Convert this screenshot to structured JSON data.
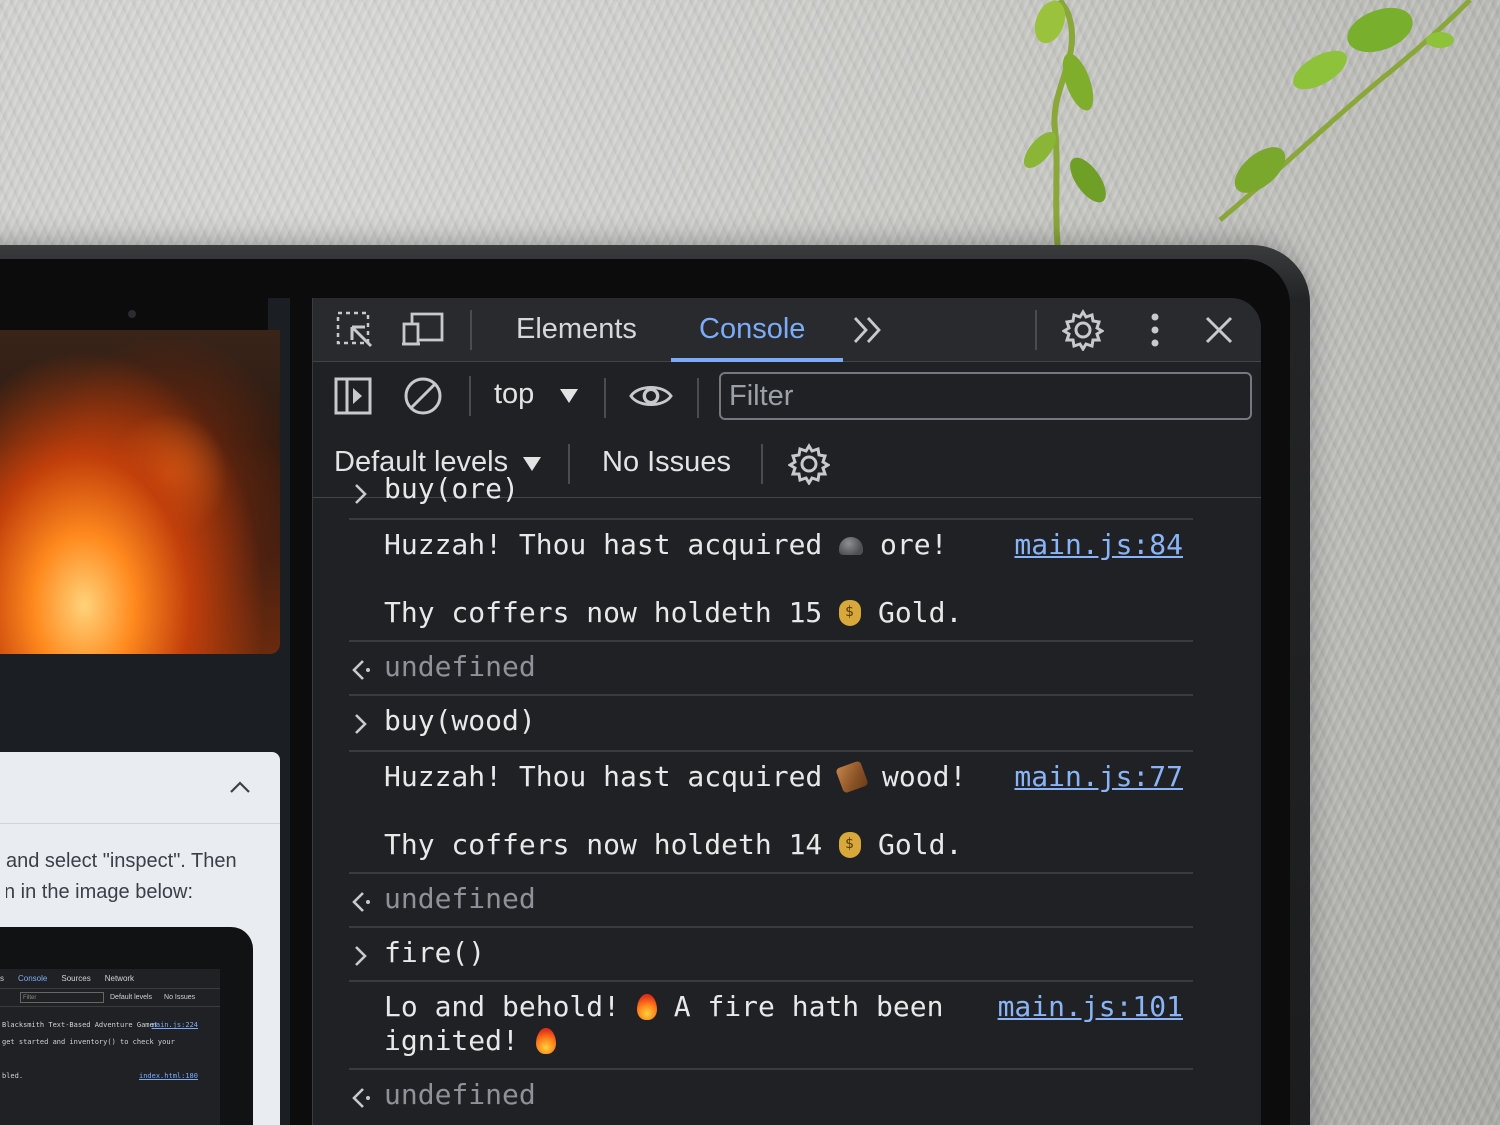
{
  "devtools": {
    "tabs": [
      {
        "label": "Elements"
      },
      {
        "label": "Console"
      }
    ],
    "context": "top",
    "filter_placeholder": "Filter",
    "levels": "Default levels",
    "issues": "No Issues"
  },
  "console": {
    "rows": [
      {
        "kind": "input-partial",
        "text": "buy(ore)"
      },
      {
        "kind": "log",
        "line1": "Huzzah! Thou hast acquired",
        "emoji1": "rock",
        "line1b": "ore!",
        "link": "main.js:84"
      },
      {
        "kind": "log2",
        "line": "Thy coffers now holdeth 15",
        "emoji": "money-bag",
        "lineb": "Gold."
      },
      {
        "kind": "return",
        "text": "undefined"
      },
      {
        "kind": "input",
        "text": "buy(wood)"
      },
      {
        "kind": "log",
        "line1": "Huzzah! Thou hast acquired",
        "emoji1": "wood",
        "line1b": "wood!",
        "link": "main.js:77"
      },
      {
        "kind": "log2",
        "line": "Thy coffers now holdeth 14",
        "emoji": "money-bag",
        "lineb": "Gold."
      },
      {
        "kind": "return",
        "text": "undefined"
      },
      {
        "kind": "input",
        "text": "fire()"
      },
      {
        "kind": "log",
        "line1": "Lo and behold!",
        "emoji1": "fire",
        "line1b": "A fire hath been",
        "line2": "ignited!",
        "emoji2": "fire",
        "link": "main.js:101"
      },
      {
        "kind": "return",
        "text": "undefined"
      }
    ]
  },
  "left_page": {
    "text_line1": "and select \"inspect\". Then",
    "text_line2": "n in the image below:",
    "mini_tabs": [
      "s",
      "Console",
      "Sources",
      "Network"
    ],
    "mini_filter": "Filter",
    "mini_levels": "Default levels",
    "mini_issues": "No Issues",
    "mini_lines": [
      {
        "text": "Blacksmith Text-Based Adventure Game!",
        "link": "main.js:224"
      },
      {
        "text": "get started and inventory() to check your",
        "link": ""
      },
      {
        "text": "",
        "link": ""
      },
      {
        "text": "bled.",
        "link": "index.html:180"
      }
    ]
  },
  "colors": {
    "accent": "#7cacf8",
    "link": "#8ab4f8",
    "panel_bg": "#202124"
  }
}
